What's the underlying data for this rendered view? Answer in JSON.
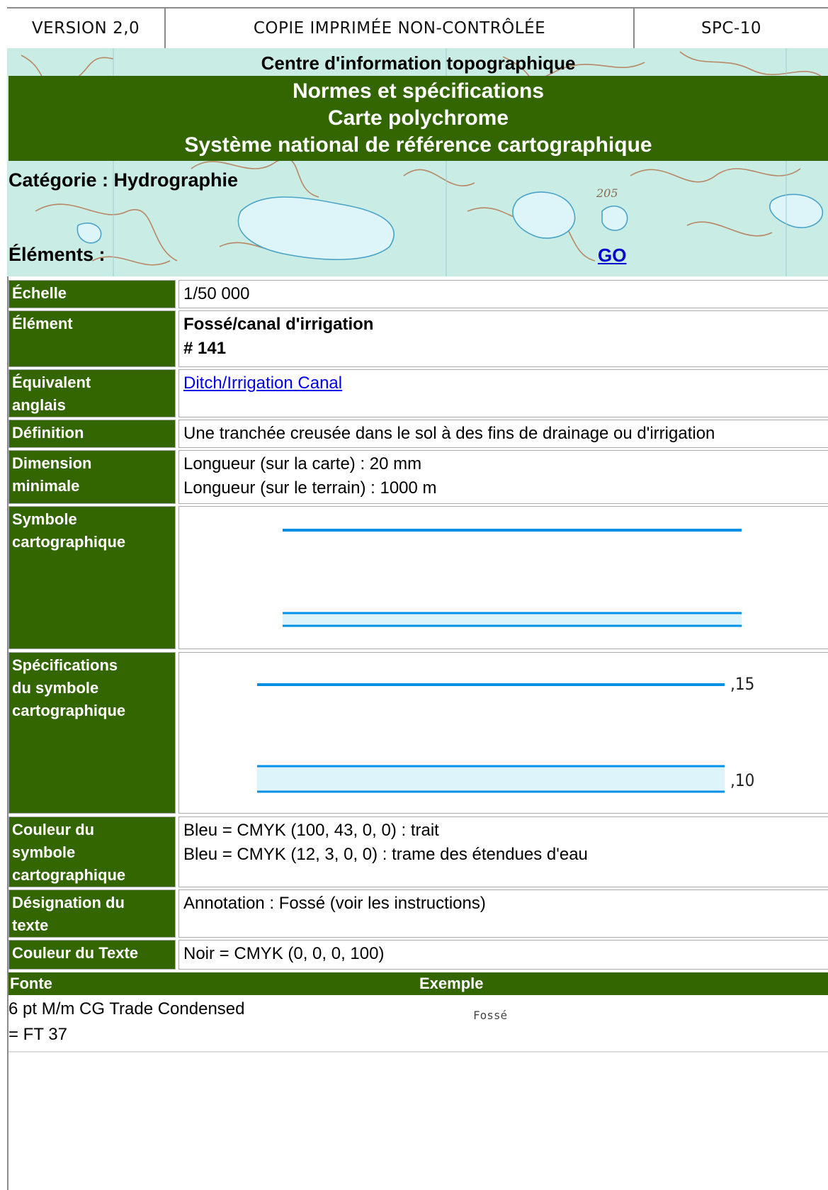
{
  "header": {
    "version": "VERSION 2,0",
    "copy_notice": "COPIE IMPRIMÉE NON-CONTRÔLÉE",
    "doc_code": "SPC-10"
  },
  "banner": {
    "centre": "Centre d'information topographique",
    "title_lines": [
      "Normes et spécifications",
      "Carte polychrome",
      "Système national de référence cartographique"
    ],
    "map_label": "205"
  },
  "selector": {
    "category": "Catégorie : Hydrographie",
    "elements": "Éléments :",
    "go": "GO"
  },
  "spec": {
    "scale_label": "Échelle",
    "scale_value": "1/50 000",
    "element_label": "Élément",
    "element_name": "Fossé/canal d'irrigation",
    "element_number": "# 141",
    "english_label_1": "Équivalent",
    "english_label_2": "anglais",
    "english_value": "Ditch/Irrigation Canal",
    "definition_label": "Définition",
    "definition_value": "Une tranchée creusée dans le sol à des fins de drainage ou d'irrigation",
    "min_dim_label_1": "Dimension",
    "min_dim_label_2": "minimale",
    "min_dim_line_1": "Longueur (sur la carte) : 20 mm",
    "min_dim_line_2": "Longueur (sur le terrain) : 1000 m",
    "symbol_label_1": "Symbole",
    "symbol_label_2": "cartographique",
    "symspec_label_1": "Spécifications",
    "symspec_label_2": "du symbole",
    "symspec_label_3": "cartographique",
    "symspec_width_1": ",15",
    "symspec_width_2": ",10",
    "color_label_1": "Couleur du",
    "color_label_2": "symbole",
    "color_label_3": "cartographique",
    "color_line_1": "Bleu = CMYK (100, 43, 0, 0) : trait",
    "color_line_2": "Bleu = CMYK (12, 3, 0, 0) : trame des étendues d'eau",
    "text_des_label_1": "Désignation du",
    "text_des_label_2": "texte",
    "text_des_value": "Annotation : Fossé (voir les instructions)",
    "text_color_label": "Couleur du Texte",
    "text_color_value": "Noir = CMYK (0, 0, 0, 100)"
  },
  "font_section": {
    "col_font": "Fonte",
    "col_example": "Exemple",
    "font_line_1": "6 pt M/m CG Trade Condensed",
    "font_line_2": "= FT 37",
    "example_text": "Fossé"
  },
  "colors": {
    "green": "#336600",
    "line_blue": "#0091e6",
    "water_tint": "#ddf4fb",
    "map_tint": "#c9ece4"
  }
}
